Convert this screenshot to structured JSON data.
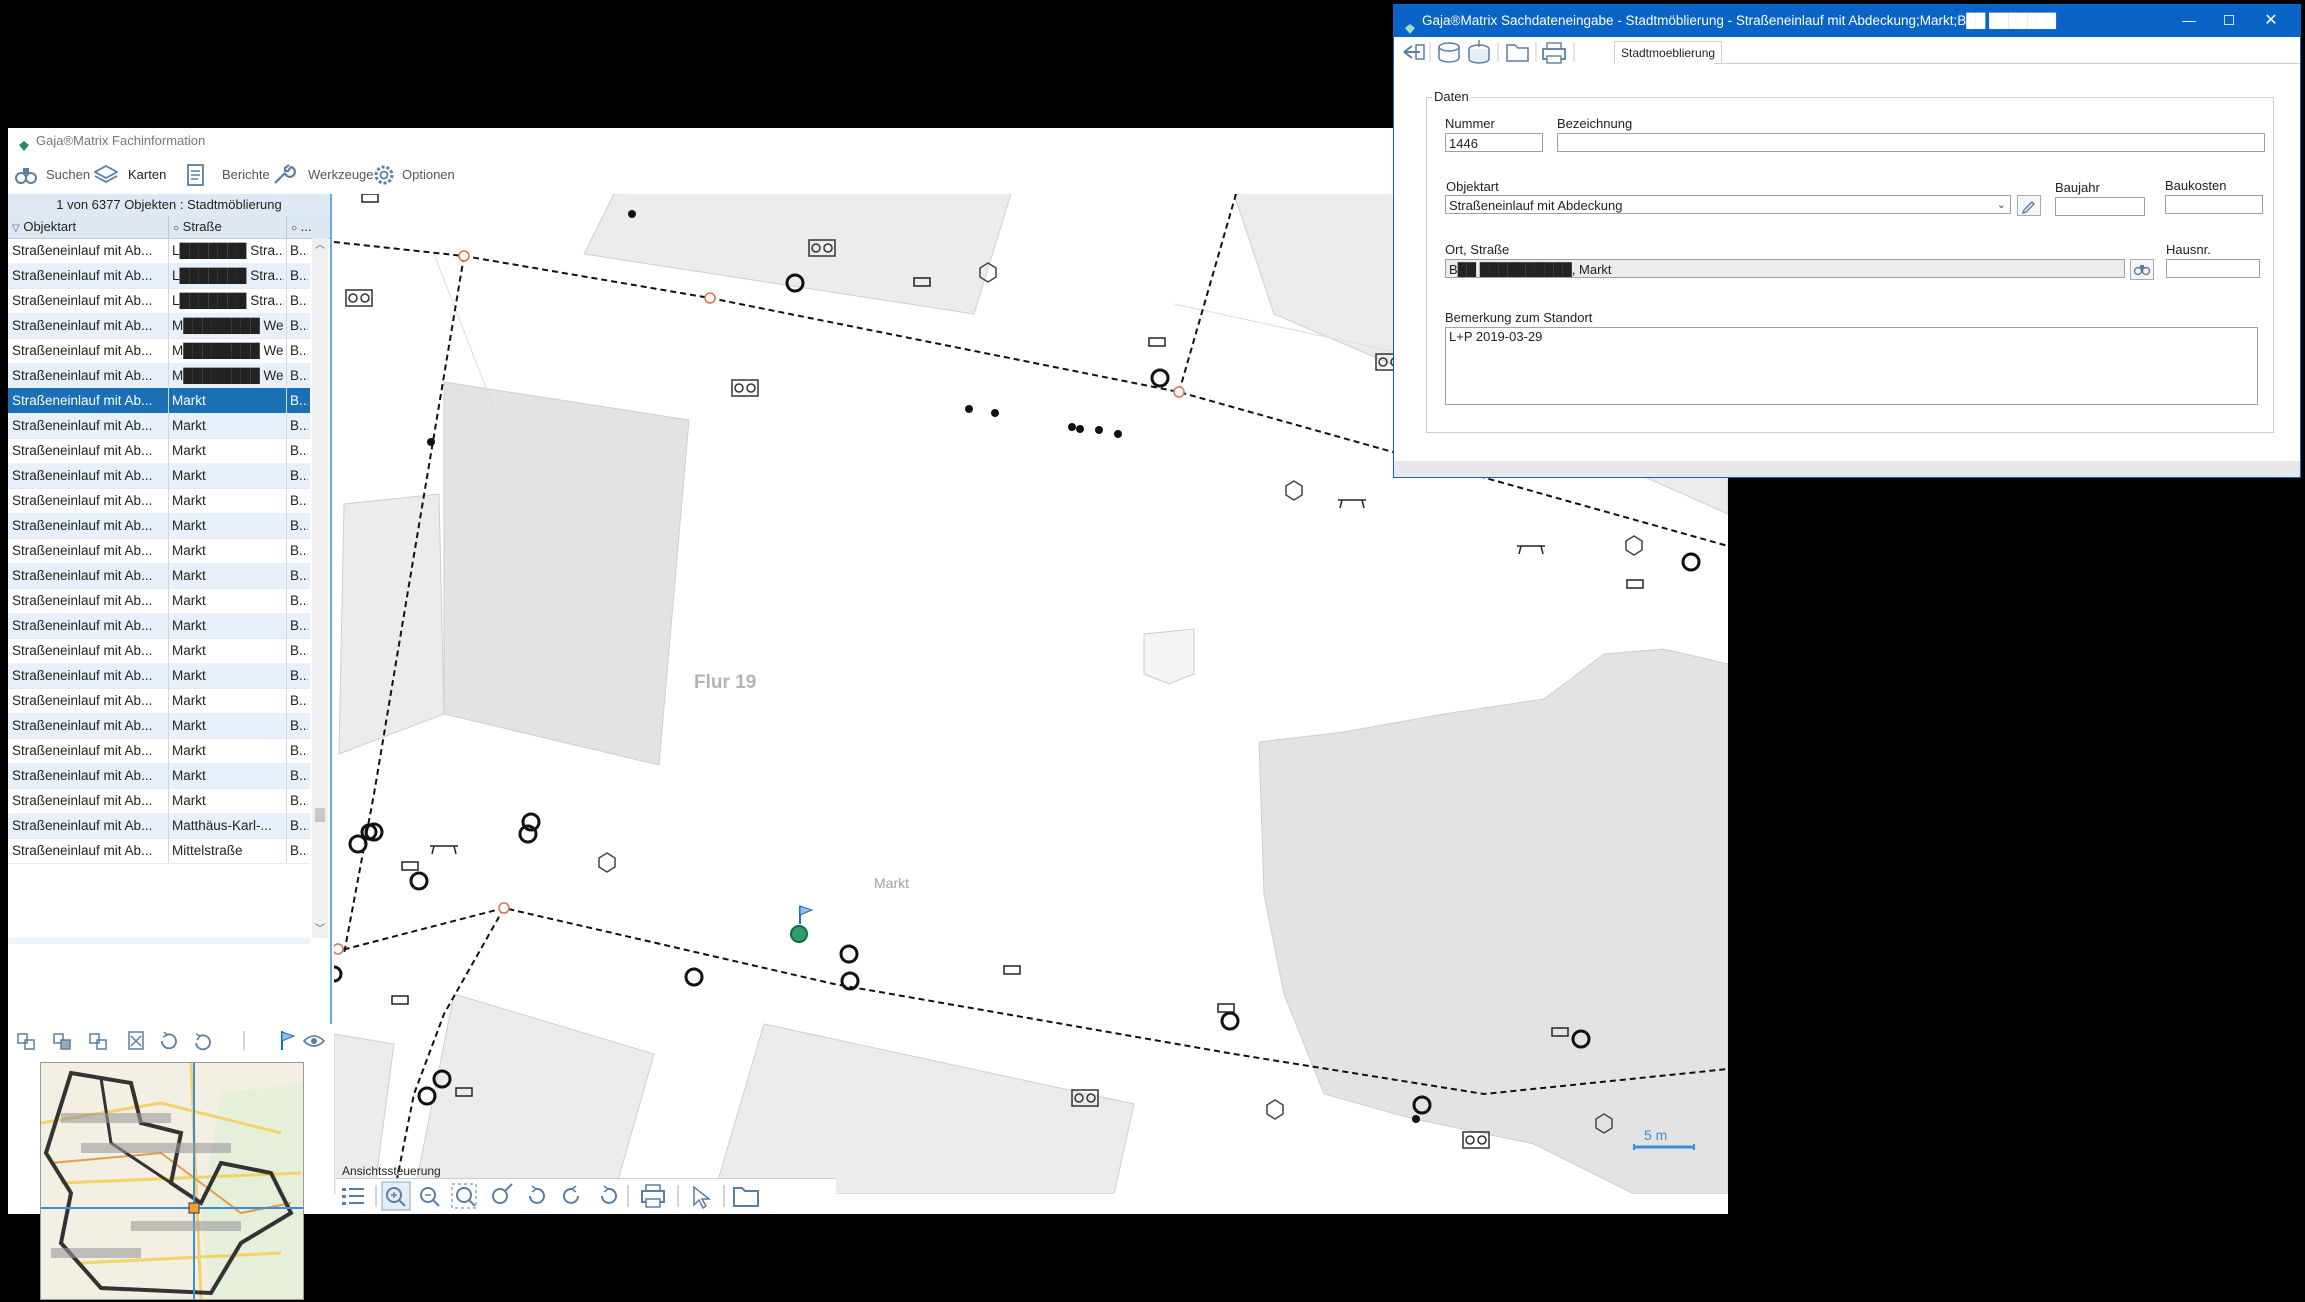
{
  "main_window": {
    "title": "Gaja®Matrix Fachinformation",
    "toolbar": [
      {
        "label": "Suchen",
        "icon": "binoculars-icon"
      },
      {
        "label": "Karten",
        "icon": "layers-icon"
      },
      {
        "label": "Berichte",
        "icon": "report-icon"
      },
      {
        "label": "Werkzeuge",
        "icon": "wrench-icon"
      },
      {
        "label": "Optionen",
        "icon": "gear-icon"
      }
    ]
  },
  "list": {
    "status": "1 von 6377 Objekten : Stadtmöblierung",
    "headers": [
      "Objektart",
      "Straße",
      "..."
    ],
    "rows": [
      {
        "objektart": "Straßeneinlauf mit Ab...",
        "strasse": "L███████ Stra...",
        "c3": "B..."
      },
      {
        "objektart": "Straßeneinlauf mit Ab...",
        "strasse": "L███████ Stra...",
        "c3": "B..."
      },
      {
        "objektart": "Straßeneinlauf mit Ab...",
        "strasse": "L███████ Stra...",
        "c3": "B..."
      },
      {
        "objektart": "Straßeneinlauf mit Ab...",
        "strasse": "M████████ Weg",
        "c3": "B..."
      },
      {
        "objektart": "Straßeneinlauf mit Ab...",
        "strasse": "M████████ Weg",
        "c3": "B..."
      },
      {
        "objektart": "Straßeneinlauf mit Ab...",
        "strasse": "M████████ Weg",
        "c3": "B..."
      },
      {
        "objektart": "Straßeneinlauf mit Ab...",
        "strasse": "Markt",
        "c3": "B...",
        "selected": true
      },
      {
        "objektart": "Straßeneinlauf mit Ab...",
        "strasse": "Markt",
        "c3": "B..."
      },
      {
        "objektart": "Straßeneinlauf mit Ab...",
        "strasse": "Markt",
        "c3": "B..."
      },
      {
        "objektart": "Straßeneinlauf mit Ab...",
        "strasse": "Markt",
        "c3": "B..."
      },
      {
        "objektart": "Straßeneinlauf mit Ab...",
        "strasse": "Markt",
        "c3": "B..."
      },
      {
        "objektart": "Straßeneinlauf mit Ab...",
        "strasse": "Markt",
        "c3": "B..."
      },
      {
        "objektart": "Straßeneinlauf mit Ab...",
        "strasse": "Markt",
        "c3": "B..."
      },
      {
        "objektart": "Straßeneinlauf mit Ab...",
        "strasse": "Markt",
        "c3": "B..."
      },
      {
        "objektart": "Straßeneinlauf mit Ab...",
        "strasse": "Markt",
        "c3": "B..."
      },
      {
        "objektart": "Straßeneinlauf mit Ab...",
        "strasse": "Markt",
        "c3": "B..."
      },
      {
        "objektart": "Straßeneinlauf mit Ab...",
        "strasse": "Markt",
        "c3": "B..."
      },
      {
        "objektart": "Straßeneinlauf mit Ab...",
        "strasse": "Markt",
        "c3": "B..."
      },
      {
        "objektart": "Straßeneinlauf mit Ab...",
        "strasse": "Markt",
        "c3": "B..."
      },
      {
        "objektart": "Straßeneinlauf mit Ab...",
        "strasse": "Markt",
        "c3": "B..."
      },
      {
        "objektart": "Straßeneinlauf mit Ab...",
        "strasse": "Markt",
        "c3": "B..."
      },
      {
        "objektart": "Straßeneinlauf mit Ab...",
        "strasse": "Markt",
        "c3": "B..."
      },
      {
        "objektart": "Straßeneinlauf mit Ab...",
        "strasse": "Markt",
        "c3": "B..."
      },
      {
        "objektart": "Straßeneinlauf mit Ab...",
        "strasse": "Matthäus-Karl-...",
        "c3": "B..."
      },
      {
        "objektart": "Straßeneinlauf mit Ab...",
        "strasse": "Mittelstraße",
        "c3": "B..."
      }
    ]
  },
  "map": {
    "labels": {
      "flur": "Flur 19",
      "markt": "Markt"
    },
    "scale": "5 m",
    "nav_title": "Ansichtssteuerung"
  },
  "dialog": {
    "title": "Gaja®Matrix Sachdateneingabe - Stadtmöblierung - Straßeneinlauf mit Abdeckung;Markt;B██ ███████",
    "tab": "Stadtmoeblierung",
    "group": "Daten",
    "fields": {
      "nummer_label": "Nummer",
      "nummer_value": "1446",
      "bezeichnung_label": "Bezeichnung",
      "bezeichnung_value": "",
      "objektart_label": "Objektart",
      "objektart_value": "Straßeneinlauf mit Abdeckung",
      "baujahr_label": "Baujahr",
      "baujahr_value": "",
      "baukosten_label": "Baukosten",
      "baukosten_value": "",
      "ort_label": "Ort, Straße",
      "ort_value": "B██ ██████████, Markt",
      "hausnr_label": "Hausnr.",
      "hausnr_value": "",
      "bemerkung_label": "Bemerkung zum Standort",
      "bemerkung_value": "L+P 2019-03-29"
    }
  },
  "colors": {
    "accent": "#0a64c8",
    "selection": "#1a6fb5",
    "row_alt": "#e8f1fb",
    "header": "#dde8f3"
  }
}
